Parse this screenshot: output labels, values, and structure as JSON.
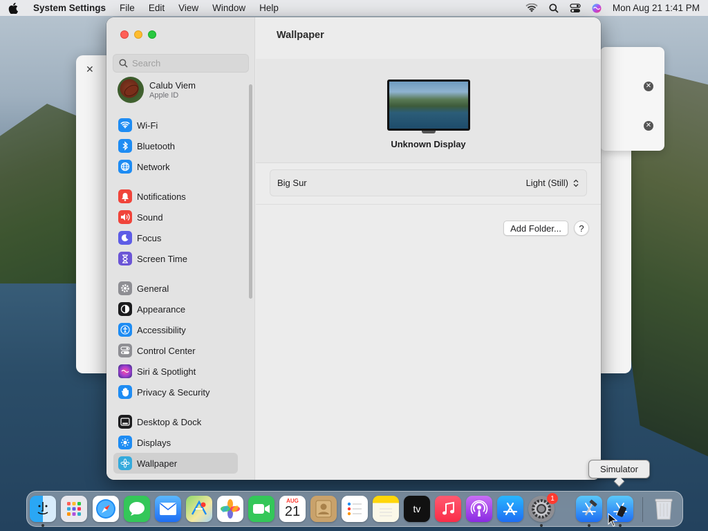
{
  "menubar": {
    "app_name": "System Settings",
    "menus": [
      "File",
      "Edit",
      "View",
      "Window",
      "Help"
    ],
    "clock": "Mon Aug 21  1:41 PM"
  },
  "search": {
    "placeholder": "Search"
  },
  "profile": {
    "name": "Calub Viem",
    "subtitle": "Apple ID"
  },
  "sidebar": {
    "items": [
      {
        "label": "Wi-Fi",
        "icon": "wifi-icon",
        "color": "#1e8cf3"
      },
      {
        "label": "Bluetooth",
        "icon": "bluetooth-icon",
        "color": "#1e8cf3"
      },
      {
        "label": "Network",
        "icon": "globe-icon",
        "color": "#1e8cf3"
      },
      {
        "label": "Notifications",
        "icon": "bell-icon",
        "color": "#f0443a"
      },
      {
        "label": "Sound",
        "icon": "speaker-icon",
        "color": "#f0443a"
      },
      {
        "label": "Focus",
        "icon": "moon-icon",
        "color": "#5d5ce6"
      },
      {
        "label": "Screen Time",
        "icon": "hourglass-icon",
        "color": "#6b55d6"
      },
      {
        "label": "General",
        "icon": "gear-icon",
        "color": "#8e8e93"
      },
      {
        "label": "Appearance",
        "icon": "appearance-icon",
        "color": "#1c1c1e"
      },
      {
        "label": "Accessibility",
        "icon": "accessibility-icon",
        "color": "#1e8cf3"
      },
      {
        "label": "Control Center",
        "icon": "toggles-icon",
        "color": "#8e8e93"
      },
      {
        "label": "Siri & Spotlight",
        "icon": "siri-icon",
        "color": "#a23fd0"
      },
      {
        "label": "Privacy & Security",
        "icon": "hand-icon",
        "color": "#1e8cf3"
      },
      {
        "label": "Desktop & Dock",
        "icon": "dock-icon",
        "color": "#1c1c1e"
      },
      {
        "label": "Displays",
        "icon": "sun-icon",
        "color": "#1e8cf3"
      },
      {
        "label": "Wallpaper",
        "icon": "flower-icon",
        "color": "#34aadc"
      }
    ],
    "selected": "Wallpaper"
  },
  "content": {
    "title": "Wallpaper",
    "display_name": "Unknown Display",
    "wallpaper_name": "Big Sur",
    "wallpaper_mode": "Light (Still)",
    "add_folder_label": "Add Folder...",
    "help_label": "?"
  },
  "tooltip": {
    "text": "Simulator"
  },
  "dock": {
    "calendar_month": "AUG",
    "calendar_day": "21",
    "settings_badge": "1",
    "tv_label": "tv"
  }
}
